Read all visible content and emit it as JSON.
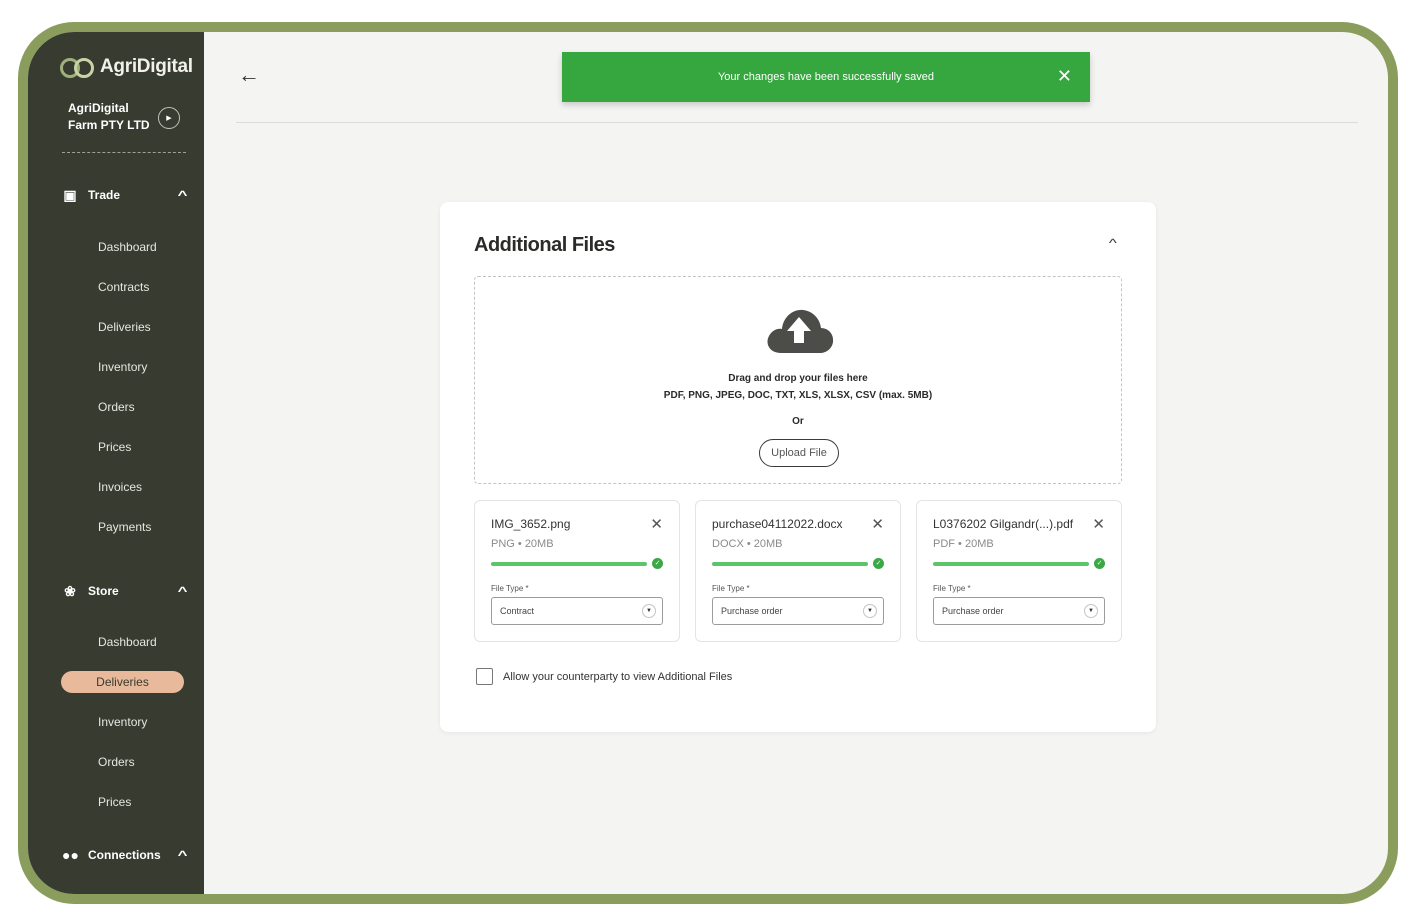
{
  "brand": {
    "name": "AgriDigital"
  },
  "company": {
    "name": "AgriDigital Farm PTY LTD"
  },
  "sidebar": {
    "sections": [
      {
        "label": "Trade",
        "icon": "document-icon",
        "items": [
          "Dashboard",
          "Contracts",
          "Deliveries",
          "Inventory",
          "Orders",
          "Prices",
          "Invoices",
          "Payments"
        ]
      },
      {
        "label": "Store",
        "icon": "wheat-icon",
        "items": [
          "Dashboard",
          "Deliveries",
          "Inventory",
          "Orders",
          "Prices"
        ],
        "active_item": "Deliveries"
      },
      {
        "label": "Connections",
        "icon": "people-icon",
        "items": []
      }
    ]
  },
  "toast": {
    "message": "Your changes have been successfully saved",
    "color": "#36a63f"
  },
  "card": {
    "title": "Additional Files",
    "drop": {
      "line1": "Drag and drop your files here",
      "line2": "PDF, PNG, JPEG, DOC, TXT, XLS, XLSX, CSV (max. 5MB)",
      "or": "Or",
      "upload_label": "Upload File"
    },
    "files": [
      {
        "name": "IMG_3652.png",
        "type": "PNG",
        "size": "20MB",
        "progress": 1.0,
        "file_type_label": "File Type *",
        "file_type_value": "Contract"
      },
      {
        "name": "purchase04112022.docx",
        "type": "DOCX",
        "size": "20MB",
        "progress": 1.0,
        "file_type_label": "File Type *",
        "file_type_value": "Purchase order"
      },
      {
        "name": "L0376202 Gilgandr(...).pdf",
        "type": "PDF",
        "size": "20MB",
        "progress": 1.0,
        "file_type_label": "File Type *",
        "file_type_value": "Purchase order"
      }
    ],
    "allow_label": "Allow your counterparty to view Additional Files",
    "allow_checked": false
  },
  "colors": {
    "sidebar": "#373b30",
    "active_nav": "#e8b99a",
    "success": "#36a63f",
    "progress": "#5cc56a"
  }
}
